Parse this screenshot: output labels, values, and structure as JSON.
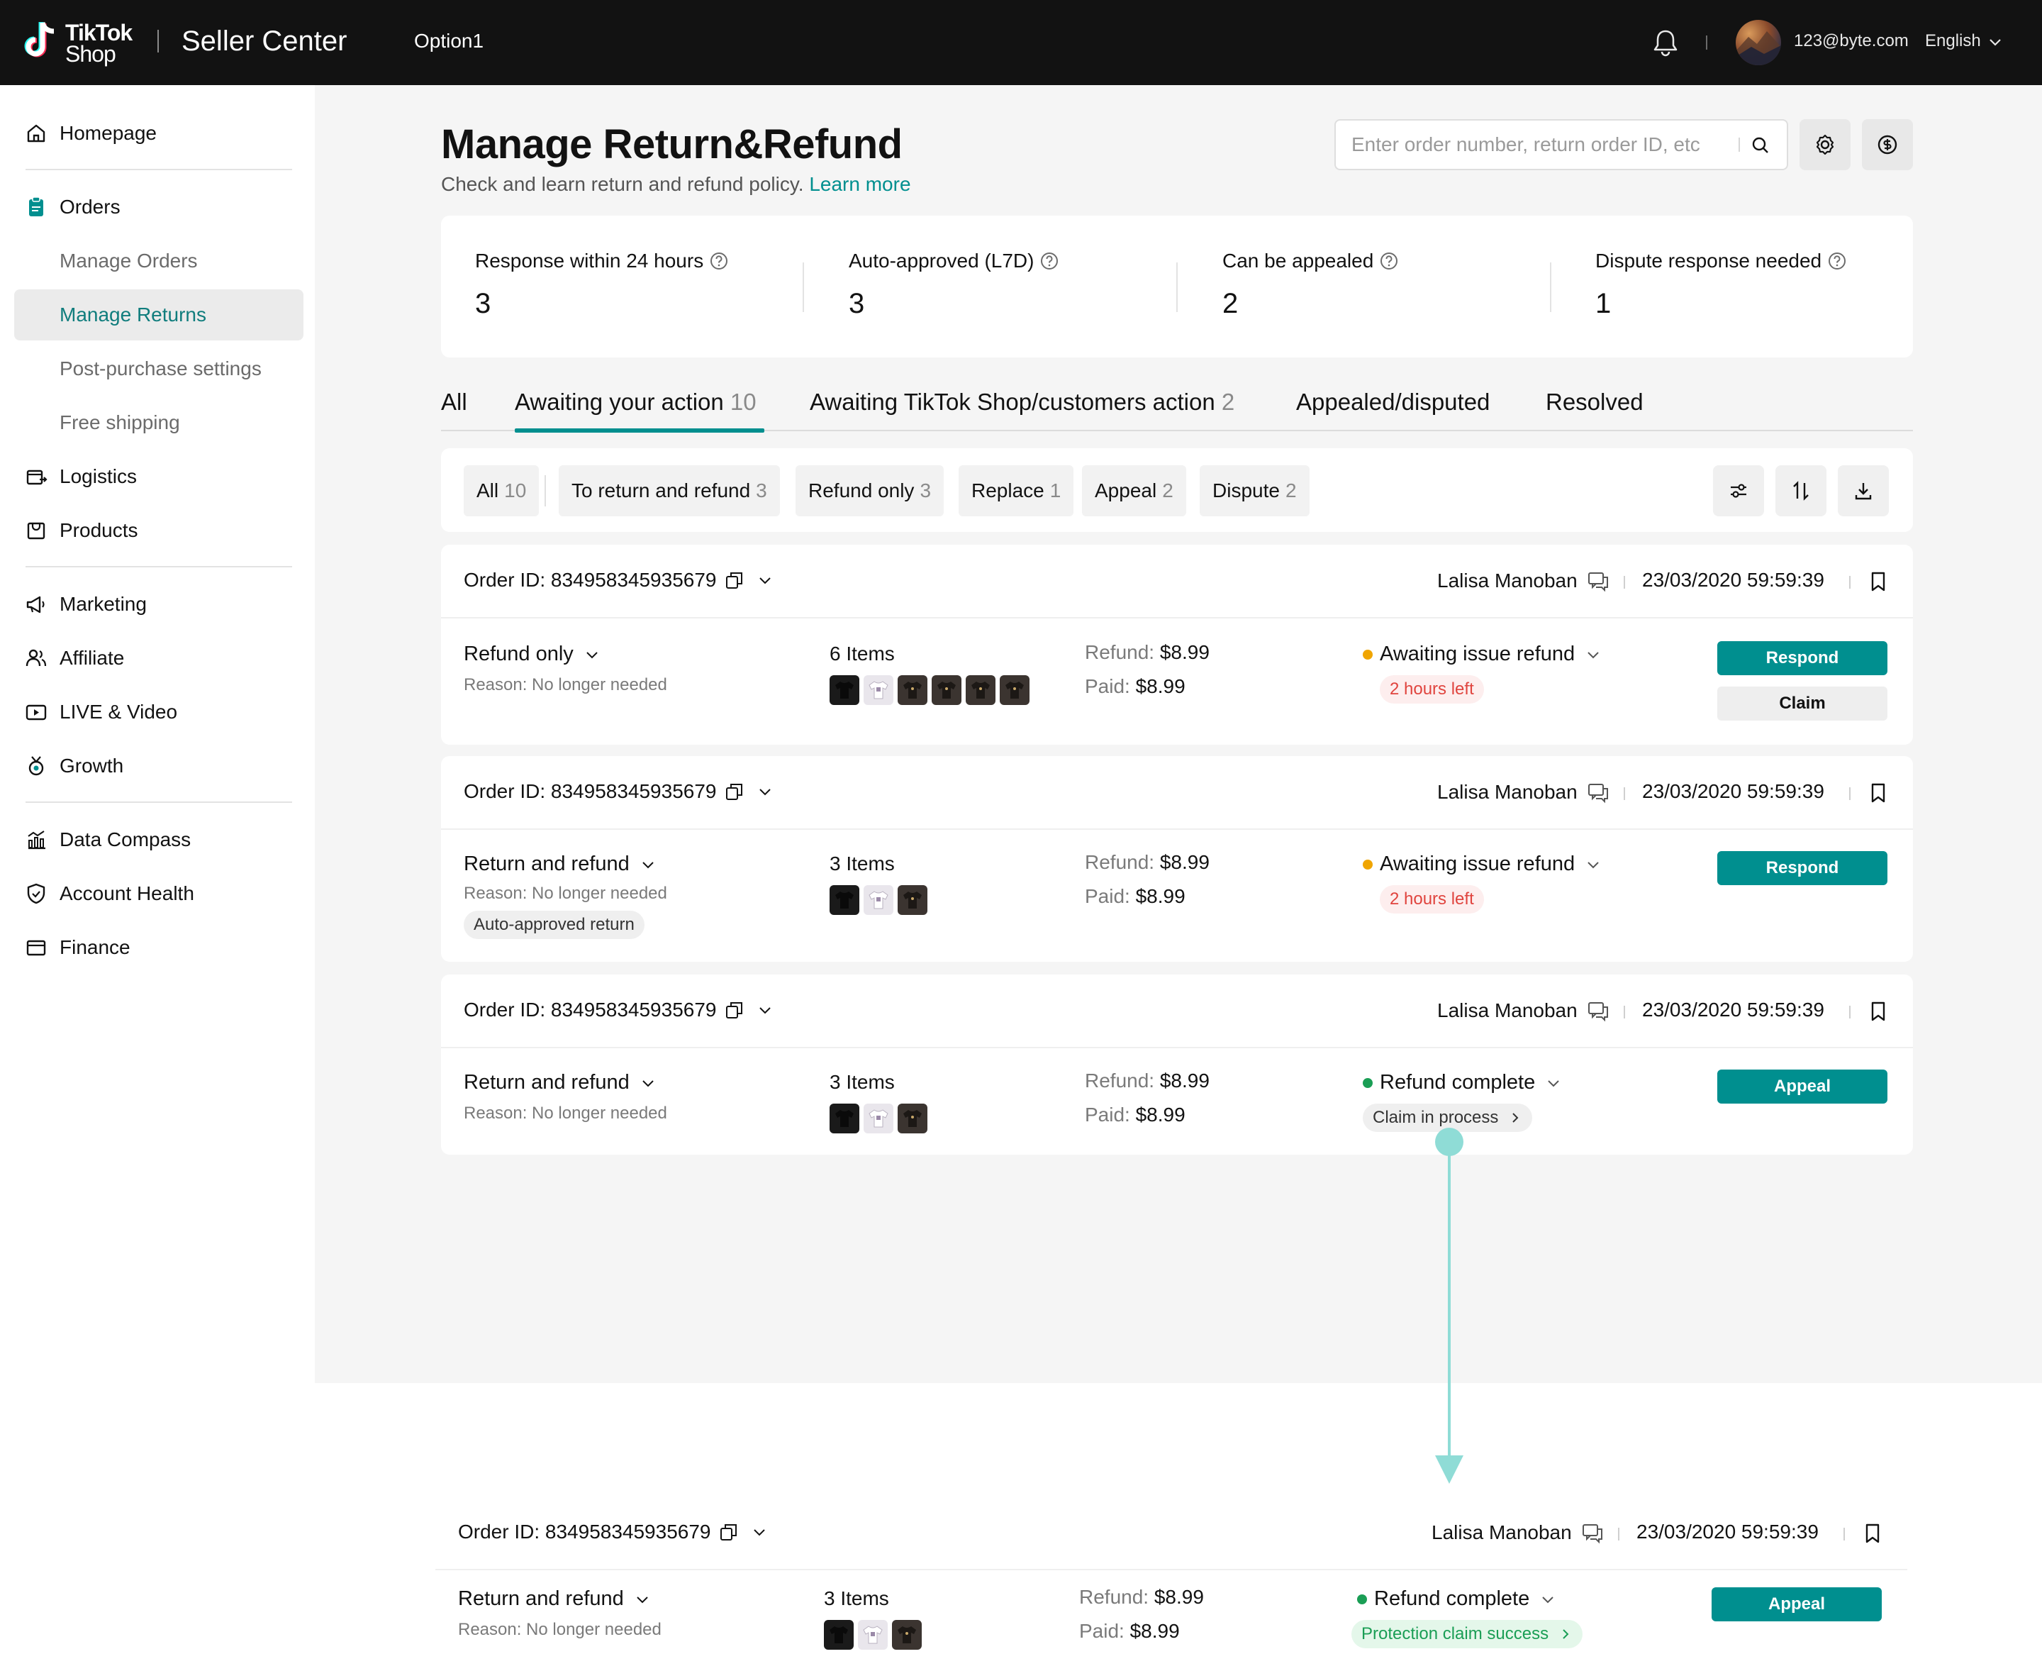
{
  "topbar": {
    "logo_line1": "TikTok",
    "logo_line2": "Shop",
    "app_title": "Seller Center",
    "option": "Option1",
    "email": "123@byte.com",
    "language": "English"
  },
  "sidebar": {
    "homepage": "Homepage",
    "orders": "Orders",
    "manage_orders": "Manage Orders",
    "manage_returns": "Manage Returns",
    "post_purchase": "Post-purchase settings",
    "free_shipping": "Free shipping",
    "logistics": "Logistics",
    "products": "Products",
    "marketing": "Marketing",
    "affiliate": "Affiliate",
    "live_video": "LIVE & Video",
    "growth": "Growth",
    "data_compass": "Data Compass",
    "account_health": "Account Health",
    "finance": "Finance"
  },
  "header": {
    "title": "Manage Return&Refund",
    "subtitle": "Check and learn return and refund policy.",
    "learn_more": "Learn more",
    "search_placeholder": "Enter order number, return order ID, etc"
  },
  "stats": [
    {
      "label": "Response within 24 hours",
      "value": "3"
    },
    {
      "label": "Auto-approved (L7D)",
      "value": "3"
    },
    {
      "label": "Can be appealed",
      "value": "2"
    },
    {
      "label": "Dispute response needed",
      "value": "1"
    }
  ],
  "tabs": [
    {
      "label": "All",
      "count": ""
    },
    {
      "label": "Awaiting your action",
      "count": "10"
    },
    {
      "label": "Awaiting TikTok Shop/customers action",
      "count": "2"
    },
    {
      "label": "Appealed/disputed",
      "count": ""
    },
    {
      "label": "Resolved",
      "count": ""
    }
  ],
  "filters": [
    {
      "label": "All",
      "count": "10"
    },
    {
      "label": "To return and refund",
      "count": "3"
    },
    {
      "label": "Refund only",
      "count": "3"
    },
    {
      "label": "Replace",
      "count": "1"
    },
    {
      "label": "Appeal",
      "count": "2"
    },
    {
      "label": "Dispute",
      "count": "2"
    }
  ],
  "orders": [
    {
      "order_id": "Order ID: 834958345935679",
      "customer": "Lalisa Manoban",
      "date": "23/03/2020 59:59:39",
      "type": "Refund only",
      "reason": "Reason: No longer needed",
      "items": "6 Items",
      "refund_label": "Refund:",
      "refund": "$8.99",
      "paid_label": "Paid:",
      "paid": "$8.99",
      "status": "Awaiting issue refund",
      "status_color": "#f0a500",
      "pill": "2 hours left",
      "primary_btn": "Respond",
      "secondary_btn": "Claim"
    },
    {
      "order_id": "Order ID: 834958345935679",
      "customer": "Lalisa Manoban",
      "date": "23/03/2020 59:59:39",
      "type": "Return and refund",
      "reason": "Reason: No longer needed",
      "tag": "Auto-approved return",
      "items": "3 Items",
      "refund_label": "Refund:",
      "refund": "$8.99",
      "paid_label": "Paid:",
      "paid": "$8.99",
      "status": "Awaiting issue refund",
      "status_color": "#f0a500",
      "pill": "2 hours left",
      "primary_btn": "Respond"
    },
    {
      "order_id": "Order ID: 834958345935679",
      "customer": "Lalisa Manoban",
      "date": "23/03/2020 59:59:39",
      "type": "Return and refund",
      "reason": "Reason: No longer needed",
      "items": "3 Items",
      "refund_label": "Refund:",
      "refund": "$8.99",
      "paid_label": "Paid:",
      "paid": "$8.99",
      "status": "Refund complete",
      "status_color": "#1a9e55",
      "pill": "Claim in process",
      "primary_btn": "Appeal"
    },
    {
      "order_id": "Order ID: 834958345935679",
      "customer": "Lalisa Manoban",
      "date": "23/03/2020 59:59:39",
      "type": "Return and refund",
      "reason": "Reason: No longer needed",
      "items": "3 Items",
      "refund_label": "Refund:",
      "refund": "$8.99",
      "paid_label": "Paid:",
      "paid": "$8.99",
      "status": "Refund complete",
      "status_color": "#1a9e55",
      "pill": "Protection claim success",
      "primary_btn": "Appeal"
    }
  ],
  "colors": {
    "brand": "#008f8f",
    "connector": "#8fdcd6",
    "warning": "#f0a500",
    "success": "#1a9e55",
    "danger": "#e0443e"
  }
}
